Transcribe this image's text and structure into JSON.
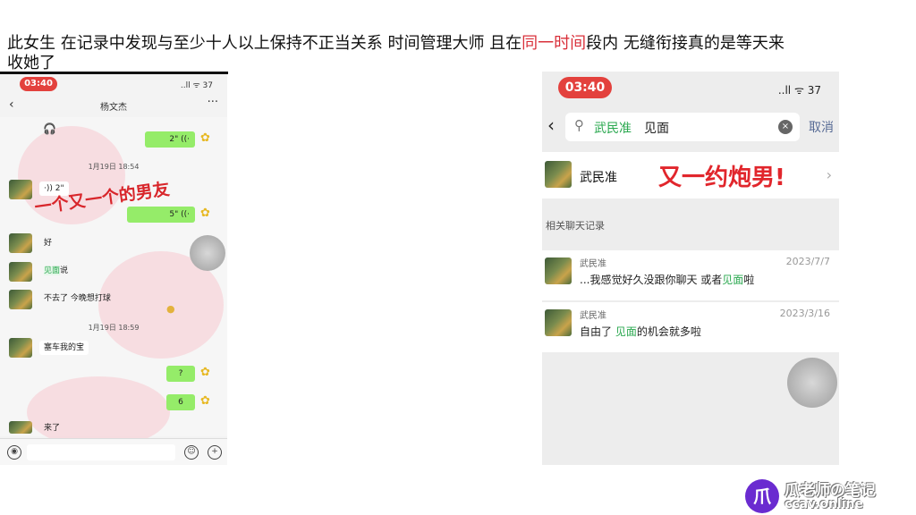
{
  "headline": {
    "part1": "此女生 在记录中发现与至少十人以上保持不正当关系 时间管理大师 且在",
    "highlight": "同一时间",
    "part2": "段内 无缝衔接真的是等天来收她了"
  },
  "left_phone": {
    "time": "03:40",
    "status": "..ll ᯤ 37",
    "title": "杨文杰",
    "overlay": "一个又一个的男友",
    "messages": {
      "m1": "2\" ((·",
      "ts1": "1月19日 18:54",
      "m2": "·)) 2\"",
      "m3": "5\" ((·",
      "m4": "好",
      "m5_hl": "见面",
      "m5_rest": "说",
      "m6": "不去了  今晚想打球",
      "ts2": "1月19日 18:59",
      "m7": "塞车我的宝",
      "m8": "?",
      "m9": "6",
      "m10": "来了"
    }
  },
  "right_phone": {
    "time": "03:40",
    "status": "..ll ᯤ 37",
    "search": {
      "query_highlight": "武民准",
      "query_rest": "见面",
      "cancel": "取消"
    },
    "contact": {
      "name": "武民准",
      "overlay": "又一约炮男!"
    },
    "section_label": "相关聊天记录",
    "records": [
      {
        "name": "武民准",
        "date": "2023/7/7",
        "pre": "...我感觉好久没跟你聊天  或者",
        "hl": "见面",
        "post": "啦"
      },
      {
        "name": "武民准",
        "date": "2023/3/16",
        "pre": "自由了  ",
        "hl": "见面",
        "post": "的机会就多啦"
      }
    ]
  },
  "watermark": {
    "badge": "爪",
    "title": "瓜老师の笔记",
    "sub": "ccav.online"
  }
}
